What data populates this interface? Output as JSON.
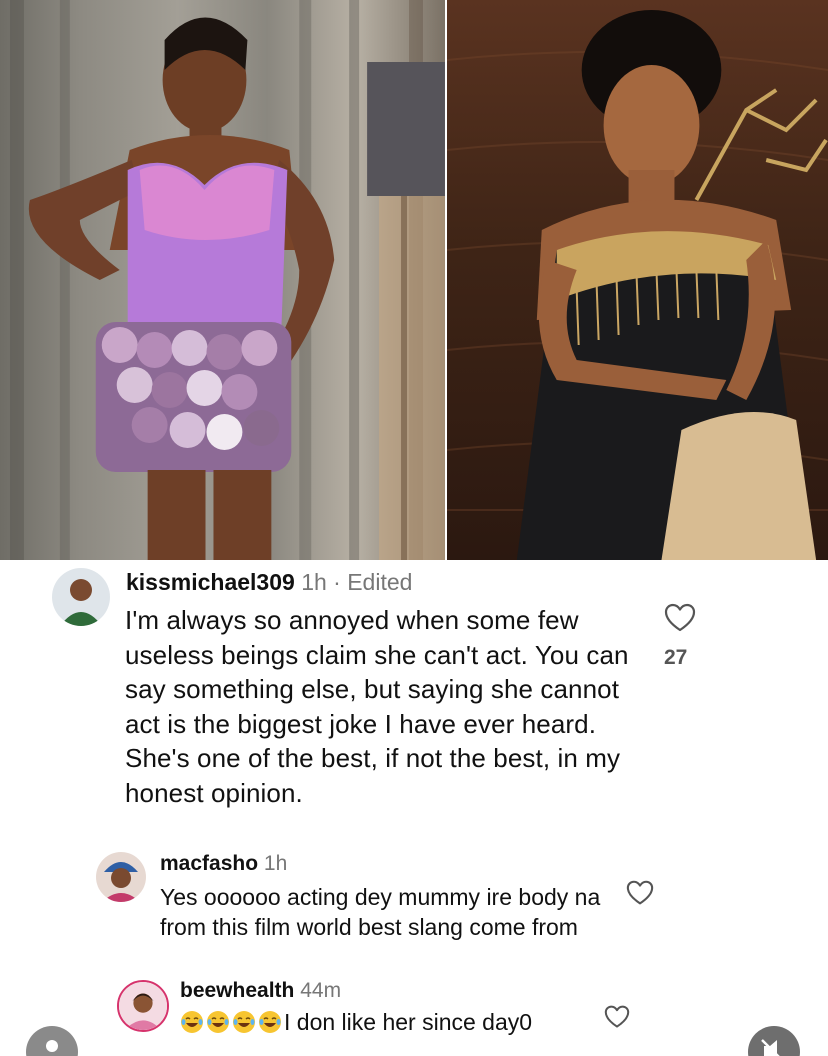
{
  "photos": {
    "left": {
      "icon": "photo-woman-purple-sequin-dress"
    },
    "right": {
      "icon": "photo-woman-black-gold-gown"
    }
  },
  "comments": [
    {
      "username": "kissmichael309",
      "time": "1h",
      "edited": "· Edited",
      "text": "I'm always so annoyed when some few useless beings claim she can't act. You can say something else, but saying she cannot act is the biggest joke I have ever heard. She's one of the best, if not the best, in my honest opinion.",
      "likes": "27",
      "avatar_icon": "avatar-man-green-shirt"
    },
    {
      "username": "macfasho",
      "time": "1h",
      "text": "Yes oooooo acting dey mummy ire body na from this film world best slang come from",
      "avatar_icon": "avatar-woman-blue-gele"
    },
    {
      "username": "beewhealth",
      "time": "44m",
      "emoji_count": 4,
      "emoji_icon": "face-with-tears-of-joy-emoji",
      "text": "I don like her since day0",
      "avatar_icon": "avatar-woman-pink"
    }
  ],
  "colors": {
    "username": "#111111",
    "meta_gray": "#777777",
    "like_gray": "#555555",
    "story_ring": "#d6336c"
  }
}
